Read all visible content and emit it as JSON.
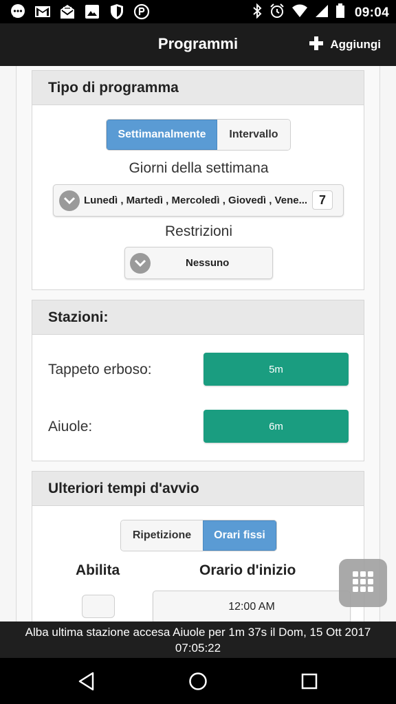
{
  "status_bar": {
    "time": "09:04",
    "left_icons": [
      "chat-icon",
      "gmail-icon",
      "mail-icon",
      "image-icon",
      "shield-icon",
      "parking-icon"
    ],
    "right_icons": [
      "bluetooth-icon",
      "alarm-icon",
      "wifi-icon",
      "signal-icon",
      "battery-icon"
    ]
  },
  "header": {
    "title": "Programmi",
    "add_label": "Aggiungi"
  },
  "program_type": {
    "title": "Tipo di programma",
    "options": [
      "Settimanalmente",
      "Intervallo"
    ],
    "selected": "Settimanalmente",
    "days_label": "Giorni della settimana",
    "days_value": "Lunedì , Martedì , Mercoledì , Giovedì , Vene...",
    "days_count": "7",
    "restrictions_label": "Restrizioni",
    "restrictions_value": "Nessuno"
  },
  "stations": {
    "title": "Stazioni:",
    "items": [
      {
        "label": "Tappeto erboso:",
        "duration": "5m"
      },
      {
        "label": "Aiuole:",
        "duration": "6m"
      }
    ]
  },
  "extra_start": {
    "title": "Ulteriori tempi d'avvio",
    "options": [
      "Ripetizione",
      "Orari fissi"
    ],
    "selected": "Orari fissi",
    "enable_label": "Abilita",
    "start_time_label": "Orario d'inizio",
    "start_time_value": "12:00 AM"
  },
  "footer": {
    "line1": "Alba ultima stazione accesa Aiuole per 1m 37s il Dom, 15 Ott 2017",
    "line2": "07:05:22"
  },
  "colors": {
    "accent_blue": "#5a9bd4",
    "station_green": "#1a9d80",
    "header_bg": "#1c1c1c"
  }
}
